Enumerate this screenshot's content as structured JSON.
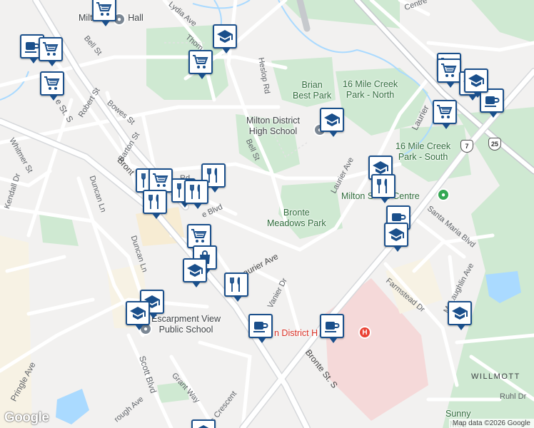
{
  "map": {
    "streets": [
      {
        "key": "lydia",
        "text": "Lydia Ave"
      },
      {
        "key": "thor",
        "text": "Thom"
      },
      {
        "key": "bell_nw",
        "text": "Bell St"
      },
      {
        "key": "heslop",
        "text": "Heslop Rd"
      },
      {
        "key": "robert",
        "text": "Robert St"
      },
      {
        "key": "bowes",
        "text": "Bowes St"
      },
      {
        "key": "main_s",
        "text": "e St. S"
      },
      {
        "key": "barton",
        "text": "Barton St"
      },
      {
        "key": "whitmer",
        "text": "Whitmer St"
      },
      {
        "key": "kendall",
        "text": "Kendall Dr"
      },
      {
        "key": "duncan_ln",
        "text": "Duncan Ln"
      },
      {
        "key": "duncan_ln2",
        "text": "Duncan Ln"
      },
      {
        "key": "bronte_w",
        "text": "Bront"
      },
      {
        "key": "bell_c",
        "text": "Bell St"
      },
      {
        "key": "laurier_n",
        "text": "Laurier Ave"
      },
      {
        "key": "laurier_ne",
        "text": "Laurier"
      },
      {
        "key": "laurier_s",
        "text": "aurier Ave"
      },
      {
        "key": "vanier",
        "text": "Vanier Dr"
      },
      {
        "key": "santa_maria",
        "text": "Santa Maria Blvd"
      },
      {
        "key": "farmstead",
        "text": "Farmstead Dr"
      },
      {
        "key": "mclaughlin",
        "text": "McLaughlin Ave"
      },
      {
        "key": "bronte_s",
        "text": "Bronte St. S"
      },
      {
        "key": "pringle",
        "text": "Pringle Ave"
      },
      {
        "key": "scott",
        "text": "Scott Blvd"
      },
      {
        "key": "grant",
        "text": "Grant Way"
      },
      {
        "key": "rough",
        "text": "rough Ave"
      },
      {
        "key": "crescent",
        "text": "ies Crescent"
      },
      {
        "key": "blvd_frag",
        "text": "e Blvd"
      },
      {
        "key": "rd_frag",
        "text": "Rd"
      },
      {
        "key": "centre_frag",
        "text": "Centre"
      }
    ],
    "places": [
      {
        "key": "town_hall",
        "text": "Milton Town Hall"
      },
      {
        "key": "brian_best",
        "text": "Brian\nBest Park"
      },
      {
        "key": "creek_north",
        "text": "16 Mile Creek\nPark - North"
      },
      {
        "key": "mdhs",
        "text": "Milton District\nHigh School"
      },
      {
        "key": "creek_south",
        "text": "16 Mile Creek\nPark - South"
      },
      {
        "key": "sports",
        "text": "Milton S     s Centre"
      },
      {
        "key": "bronte_meadows",
        "text": "Bronte\nMeadows Park"
      },
      {
        "key": "escarpment",
        "text": "Escarpment View\nPublic School"
      },
      {
        "key": "hospital",
        "text": "n District H     al"
      },
      {
        "key": "willmott",
        "text": "WILLMOTT"
      },
      {
        "key": "ruhl",
        "text": "Ruhl Dr"
      },
      {
        "key": "sunny",
        "text": "Sunny\nMou"
      }
    ],
    "shields": [
      "7",
      "25"
    ],
    "markers": [
      {
        "icon": "cart-icon"
      },
      {
        "icon": "coffee-icon"
      },
      {
        "icon": "cart-icon"
      },
      {
        "icon": "cart-icon"
      },
      {
        "icon": "school-icon"
      },
      {
        "icon": "cart-icon"
      },
      {
        "icon": "school-icon"
      },
      {
        "icon": "cart-icon"
      },
      {
        "icon": "cart-icon"
      },
      {
        "icon": "school-icon"
      },
      {
        "icon": "coffee-icon"
      },
      {
        "icon": "school-icon"
      },
      {
        "icon": "cart-icon"
      },
      {
        "icon": "school-icon"
      },
      {
        "icon": "restaurant-icon"
      },
      {
        "icon": "restaurant-icon"
      },
      {
        "icon": "cart-icon"
      },
      {
        "icon": "restaurant-icon"
      },
      {
        "icon": "restaurant-icon"
      },
      {
        "icon": "restaurant-icon"
      },
      {
        "icon": "restaurant-icon"
      },
      {
        "icon": "restaurant-icon"
      },
      {
        "icon": "coffee-icon"
      },
      {
        "icon": "school-icon"
      },
      {
        "icon": "cart-icon"
      },
      {
        "icon": "shopping-bag-icon"
      },
      {
        "icon": "school-icon"
      },
      {
        "icon": "restaurant-icon"
      },
      {
        "icon": "school-icon"
      },
      {
        "icon": "school-icon"
      },
      {
        "icon": "coffee-icon"
      },
      {
        "icon": "coffee-icon"
      },
      {
        "icon": "school-icon"
      }
    ],
    "colors": {
      "land": "#f2f1f0",
      "park": "#cfe9d2",
      "water": "#aadaff",
      "road": "#ffffff",
      "road_edge": "#dadce0",
      "major_road": "#c6c9cd",
      "hospital": "#f5d9d9",
      "marker_border": "#1a4f8b",
      "marker_icon": "#1a4f8b"
    }
  },
  "branding": {
    "logo": "Google",
    "attribution": "Map data ©2026 Google"
  }
}
